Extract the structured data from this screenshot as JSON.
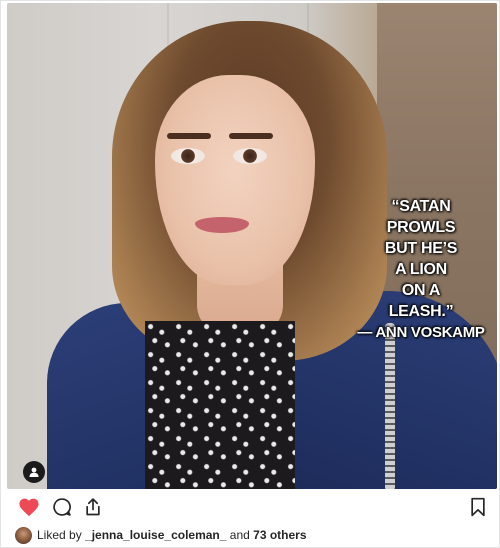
{
  "post": {
    "quote_lines": [
      "“SATAN",
      "PROWLS",
      "BUT HE’S",
      "A LION",
      "ON A",
      "LEASH.”"
    ],
    "quote_attribution": "— ANN VOSKAMP"
  },
  "actions": {
    "like_icon": "heart-filled-icon",
    "comment_icon": "comment-icon",
    "share_icon": "share-icon",
    "save_icon": "bookmark-icon",
    "like_color": "#ed4956"
  },
  "likes": {
    "prefix": "Liked by ",
    "user": "_jenna_louise_coleman_",
    "middle": " and ",
    "others": "73 others"
  }
}
